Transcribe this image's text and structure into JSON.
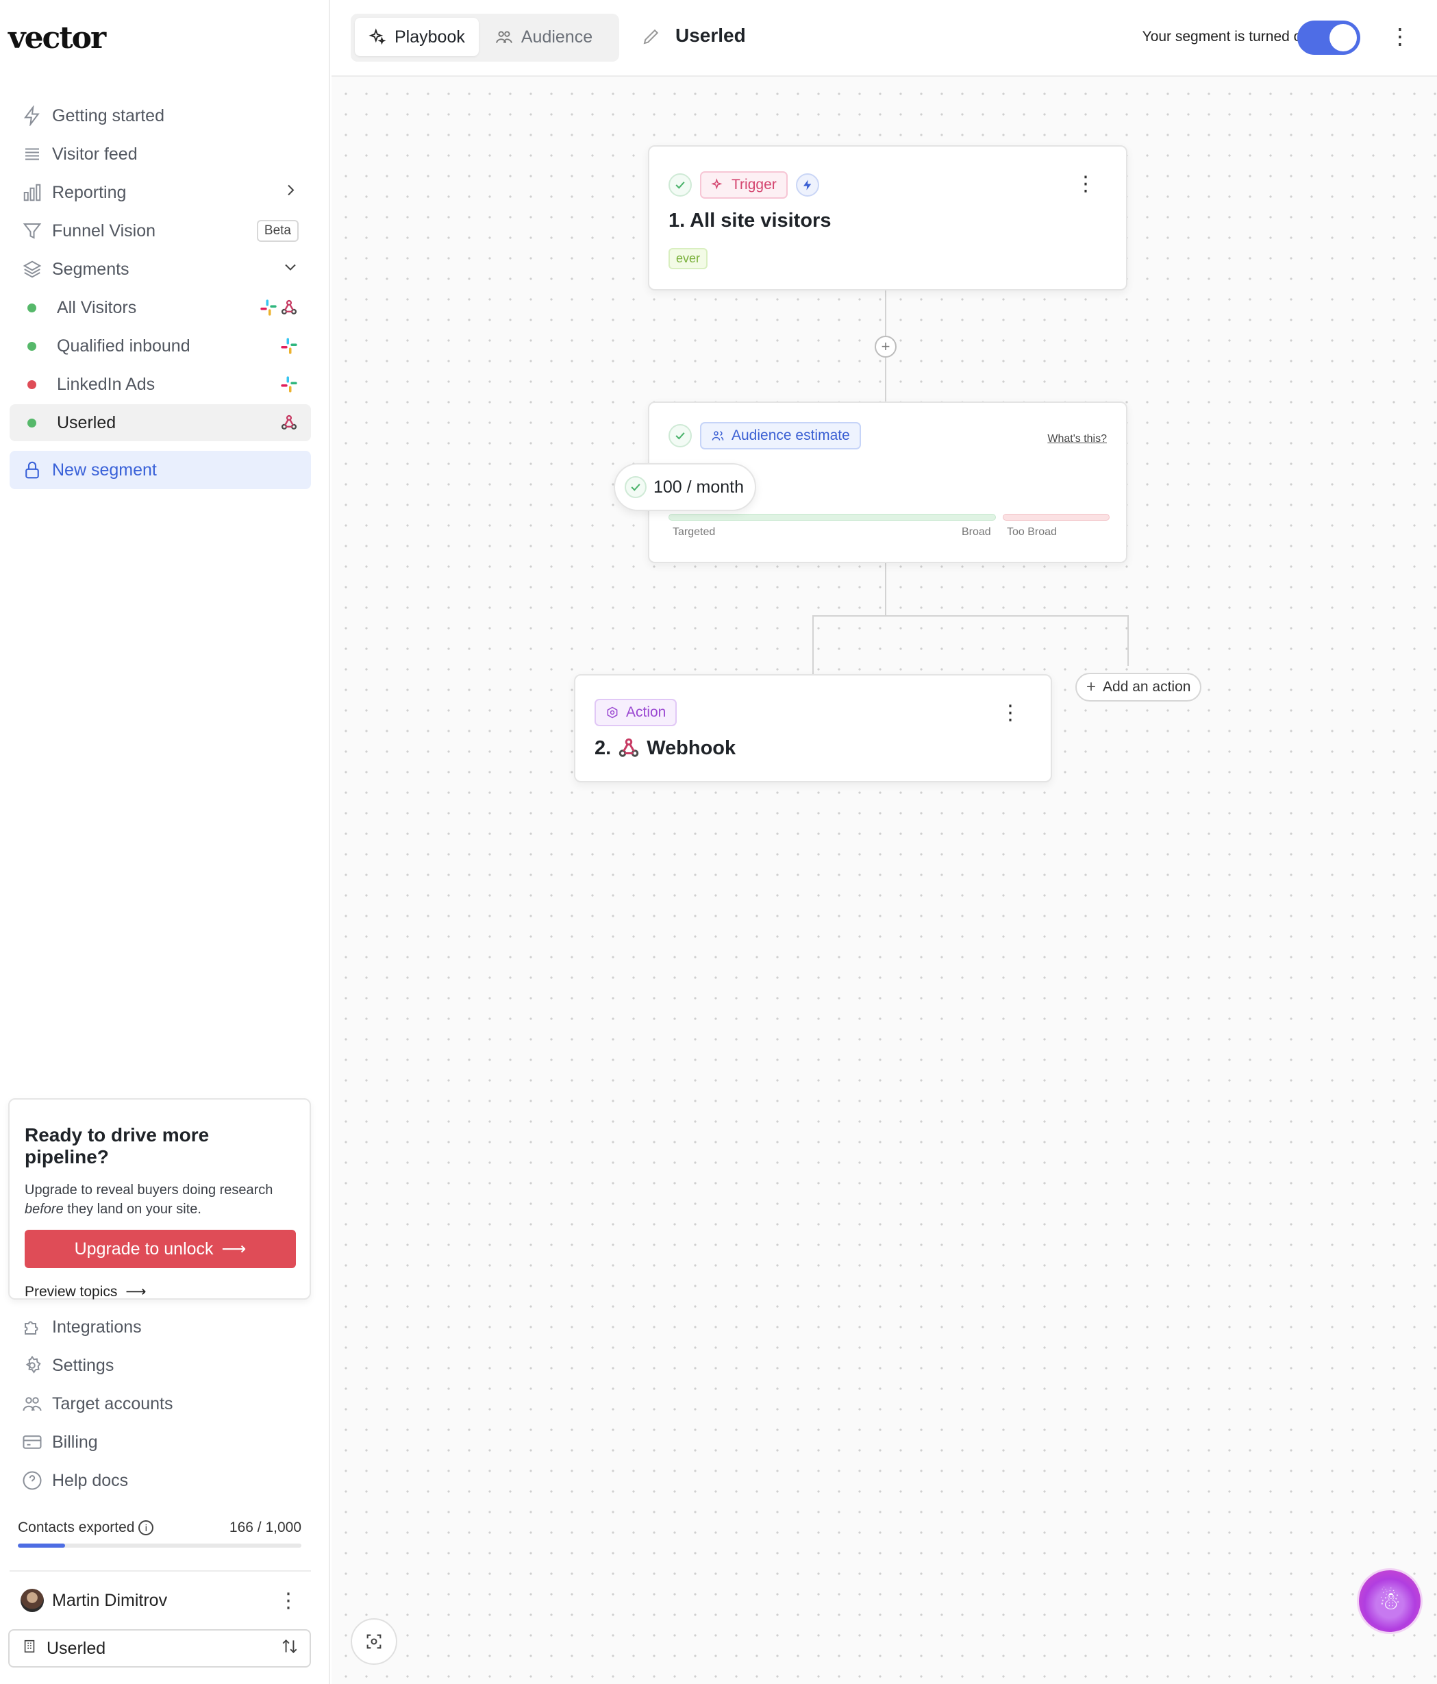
{
  "app": {
    "logo": "vector"
  },
  "sidebar": {
    "nav": [
      {
        "label": "Getting started",
        "icon": "bolt-icon"
      },
      {
        "label": "Visitor feed",
        "icon": "list-icon"
      },
      {
        "label": "Reporting",
        "icon": "bar-chart-icon"
      },
      {
        "label": "Funnel Vision",
        "icon": "funnel-icon",
        "badge": "Beta"
      },
      {
        "label": "Segments",
        "icon": "layers-icon"
      }
    ],
    "segments": [
      {
        "label": "All Visitors",
        "status_color": "#56b86a",
        "integrations": [
          "slack",
          "webhook"
        ]
      },
      {
        "label": "Qualified inbound",
        "status_color": "#56b86a",
        "integrations": [
          "slack"
        ]
      },
      {
        "label": "LinkedIn Ads",
        "status_color": "#df4c57",
        "integrations": [
          "slack"
        ]
      },
      {
        "label": "Userled",
        "status_color": "#56b86a",
        "integrations": [
          "webhook"
        ],
        "active": true
      }
    ],
    "new_segment": "New segment",
    "upsell": {
      "title": "Ready to drive more pipeline?",
      "body_before": "Upgrade to reveal buyers doing research ",
      "body_em": "before",
      "body_after": " they land on your site.",
      "button": "Upgrade to unlock",
      "link": "Preview topics"
    },
    "bottom_nav": [
      {
        "label": "Integrations",
        "icon": "puzzle-icon"
      },
      {
        "label": "Settings",
        "icon": "gear-icon"
      },
      {
        "label": "Target accounts",
        "icon": "users-icon"
      },
      {
        "label": "Billing",
        "icon": "credit-card-icon"
      },
      {
        "label": "Help docs",
        "icon": "help-circle-icon"
      }
    ],
    "contacts": {
      "label": "Contacts exported",
      "value": "166 / 1,000",
      "used": 166,
      "limit": 1000
    },
    "user": {
      "name": "Martin Dimitrov"
    },
    "workspace": {
      "name": "Userled"
    }
  },
  "topbar": {
    "tabs": [
      {
        "label": "Playbook",
        "icon": "sparkle-icon",
        "active": true
      },
      {
        "label": "Audience",
        "icon": "users-icon",
        "active": false
      }
    ],
    "segment_name": "Userled",
    "toggle_label": "Your segment is turned on",
    "toggle_on": true
  },
  "canvas": {
    "trigger": {
      "pill": "Trigger",
      "title": "1. All site visitors",
      "badge": "ever"
    },
    "audience": {
      "pill": "Audience estimate",
      "help_link": "What's this?",
      "estimate": "100 / month",
      "labels": {
        "targeted": "Targeted",
        "broad": "Broad",
        "too_broad": "Too Broad"
      }
    },
    "action": {
      "pill": "Action",
      "title_prefix": "2.",
      "title": "Webhook"
    },
    "add_action": "Add an action"
  },
  "colors": {
    "accent": "#4e6de6",
    "danger": "#df4c57",
    "success": "#56b86a"
  }
}
